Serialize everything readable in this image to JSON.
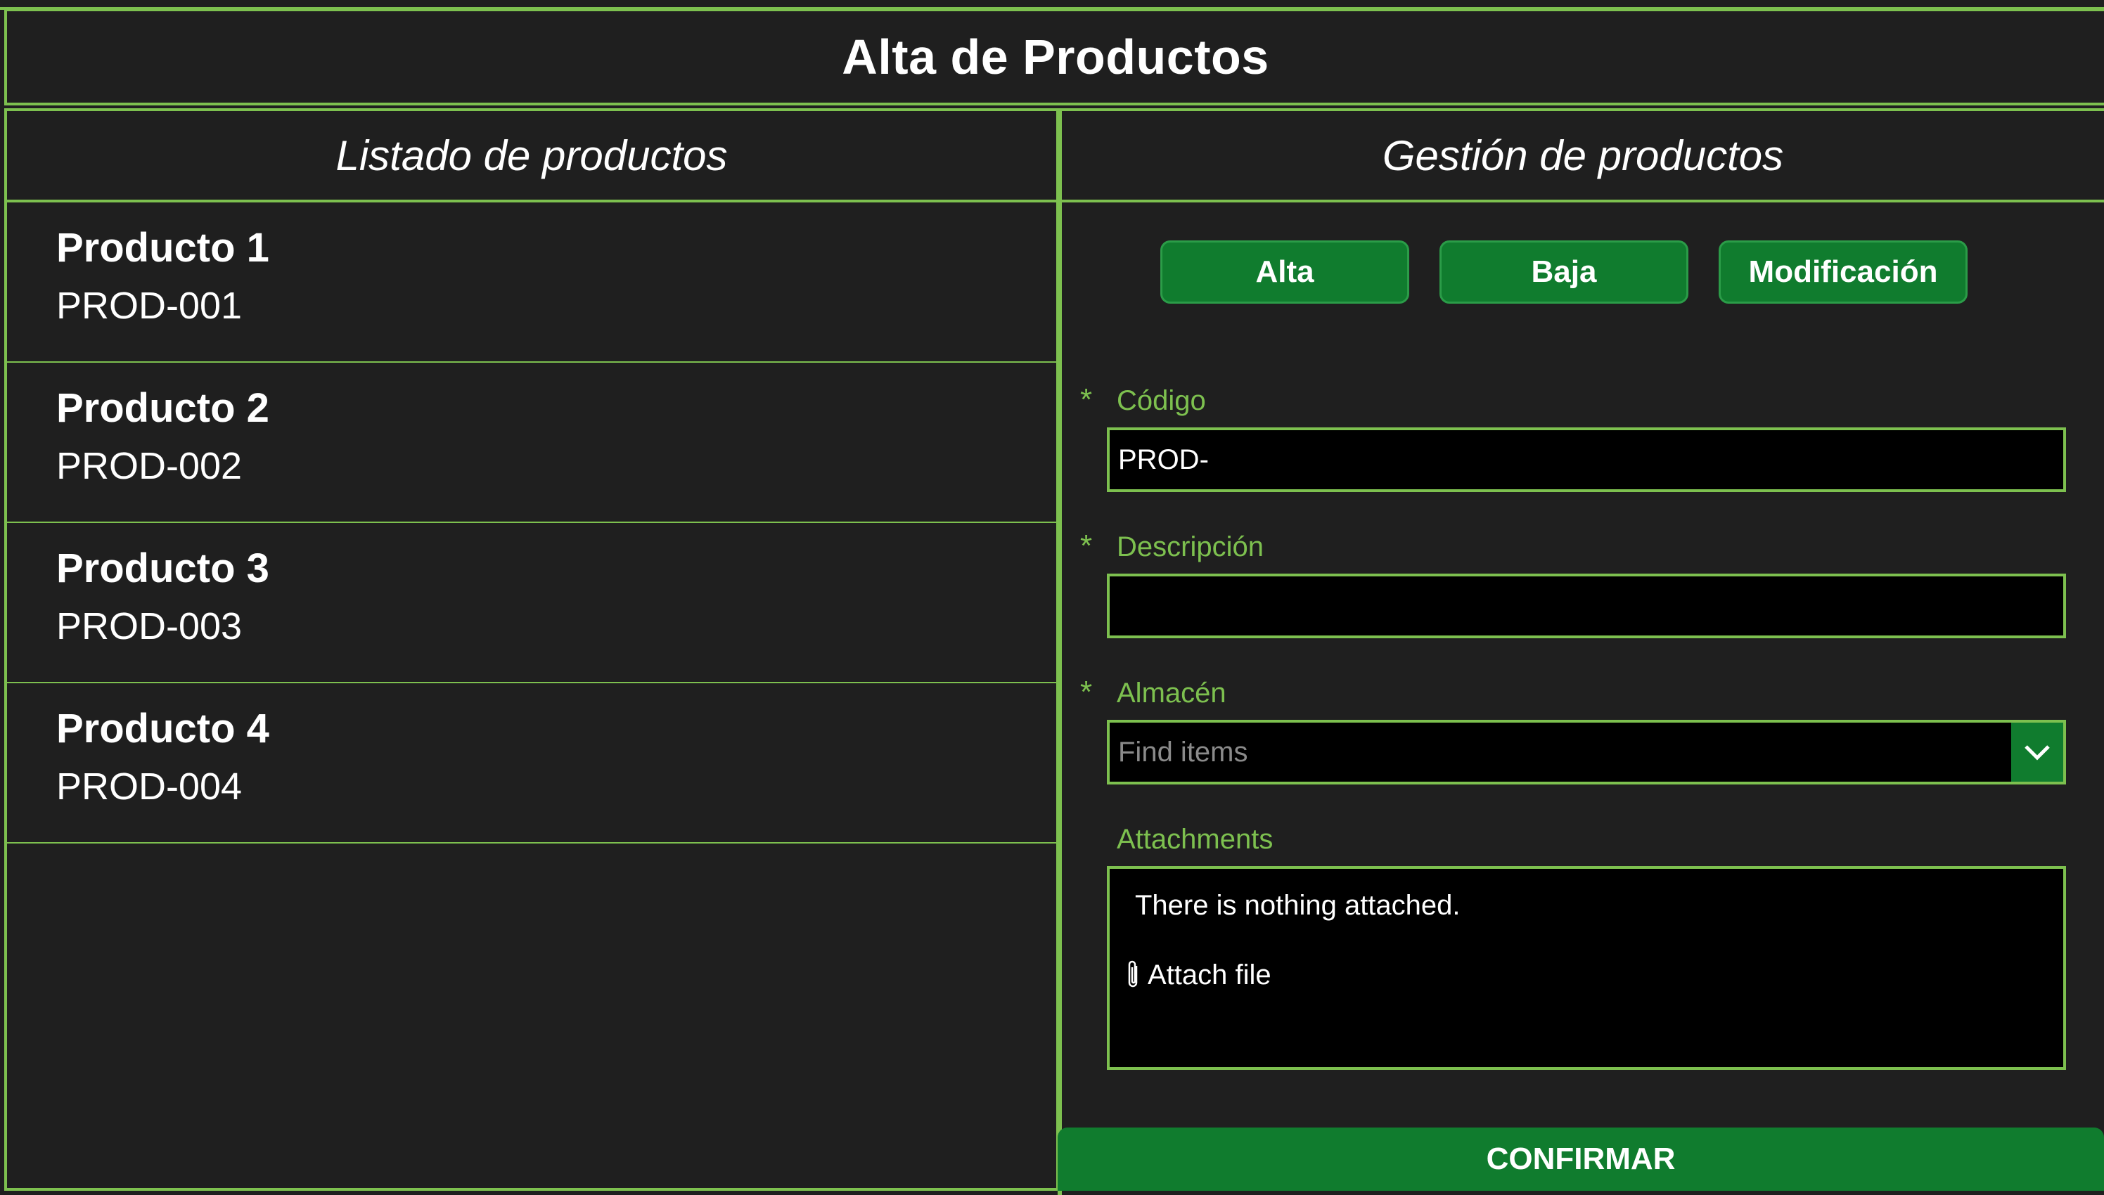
{
  "header": {
    "title": "Alta de Productos"
  },
  "list_section": {
    "title": "Listado de productos",
    "items": [
      {
        "name": "Producto 1",
        "code": "PROD-001"
      },
      {
        "name": "Producto 2",
        "code": "PROD-002"
      },
      {
        "name": "Producto 3",
        "code": "PROD-003"
      },
      {
        "name": "Producto 4",
        "code": "PROD-004"
      }
    ]
  },
  "form_section": {
    "title": "Gestión de productos",
    "actions": {
      "alta": "Alta",
      "baja": "Baja",
      "modificacion": "Modificación"
    },
    "codigo": {
      "label": "Código",
      "required_mark": "*",
      "value": "PROD-"
    },
    "descripcion": {
      "label": "Descripción",
      "required_mark": "*",
      "value": ""
    },
    "almacen": {
      "label": "Almacén",
      "required_mark": "*",
      "placeholder": "Find items"
    },
    "attachments": {
      "label": "Attachments",
      "empty_text": "There is nothing attached.",
      "attach_label": "Attach file"
    },
    "confirm_label": "CONFIRMAR"
  },
  "colors": {
    "accent": "#7dc04f",
    "button": "#107c2e",
    "panel": "#1f1f1f",
    "input_bg": "#000000"
  },
  "icons": {
    "dropdown": "chevron-down-icon",
    "attach": "paperclip-icon"
  }
}
